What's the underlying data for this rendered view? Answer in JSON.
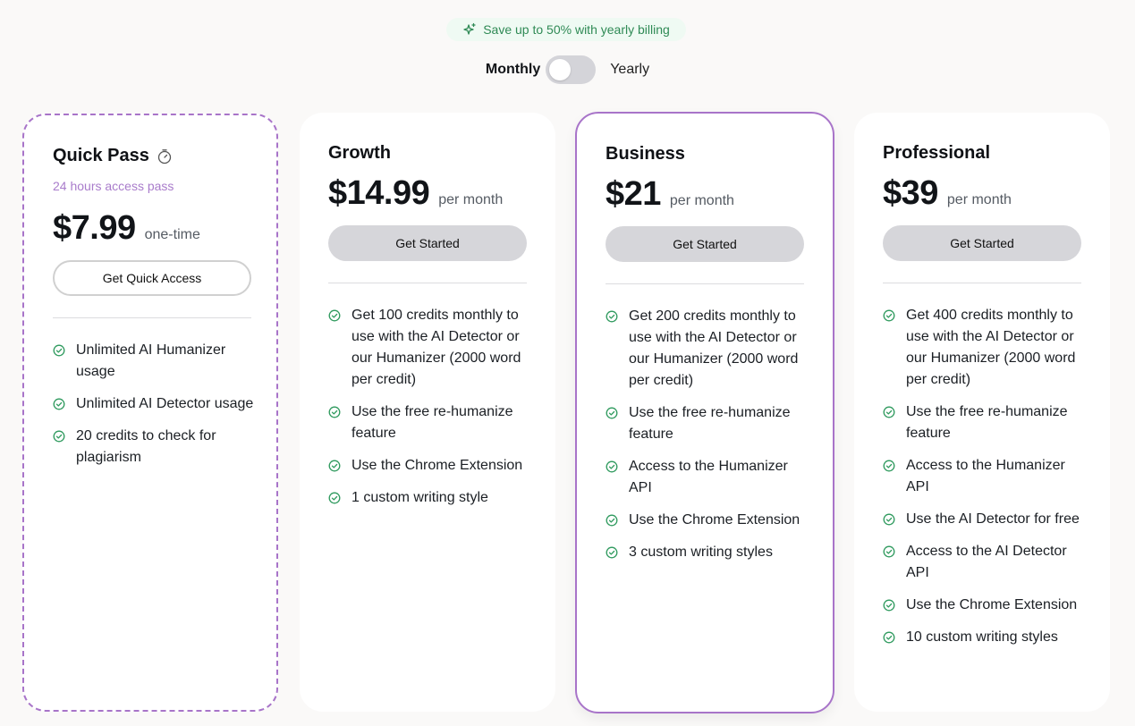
{
  "promo": {
    "icon": "sparkle-icon",
    "text": "Save up to 50% with yearly billing",
    "color": "#2f8a55"
  },
  "billing": {
    "monthly_label": "Monthly",
    "yearly_label": "Yearly",
    "selected": "Monthly"
  },
  "accent_color": "#a874c9",
  "plans": [
    {
      "name": "Quick Pass",
      "icon": "timer-icon",
      "subtitle": "24 hours access pass",
      "price": "$7.99",
      "period": "one-time",
      "button": "Get Quick Access",
      "features": [
        "Unlimited AI Humanizer usage",
        "Unlimited AI Detector usage",
        "20 credits to check for plagiarism"
      ]
    },
    {
      "name": "Growth",
      "price": "$14.99",
      "period": "per month",
      "button": "Get Started",
      "features": [
        "Get 100 credits monthly to use with the AI Detector or our Humanizer (2000 word per credit)",
        "Use the free re-humanize feature",
        "Use the Chrome Extension",
        "1 custom writing style"
      ]
    },
    {
      "name": "Business",
      "highlighted": true,
      "price": "$21",
      "period": "per month",
      "button": "Get Started",
      "features": [
        "Get 200 credits monthly to use with the AI Detector or our Humanizer (2000 word per credit)",
        "Use the free re-humanize feature",
        "Access to the Humanizer API",
        "Use the Chrome Extension",
        "3 custom writing styles"
      ]
    },
    {
      "name": "Professional",
      "price": "$39",
      "period": "per month",
      "button": "Get Started",
      "features": [
        "Get 400 credits monthly to use with the AI Detector or our Humanizer (2000 word per credit)",
        "Use the free re-humanize feature",
        "Access to the Humanizer API",
        "Use the AI Detector for free",
        "Access to the AI Detector API",
        "Use the Chrome Extension",
        "10 custom writing styles"
      ]
    }
  ]
}
